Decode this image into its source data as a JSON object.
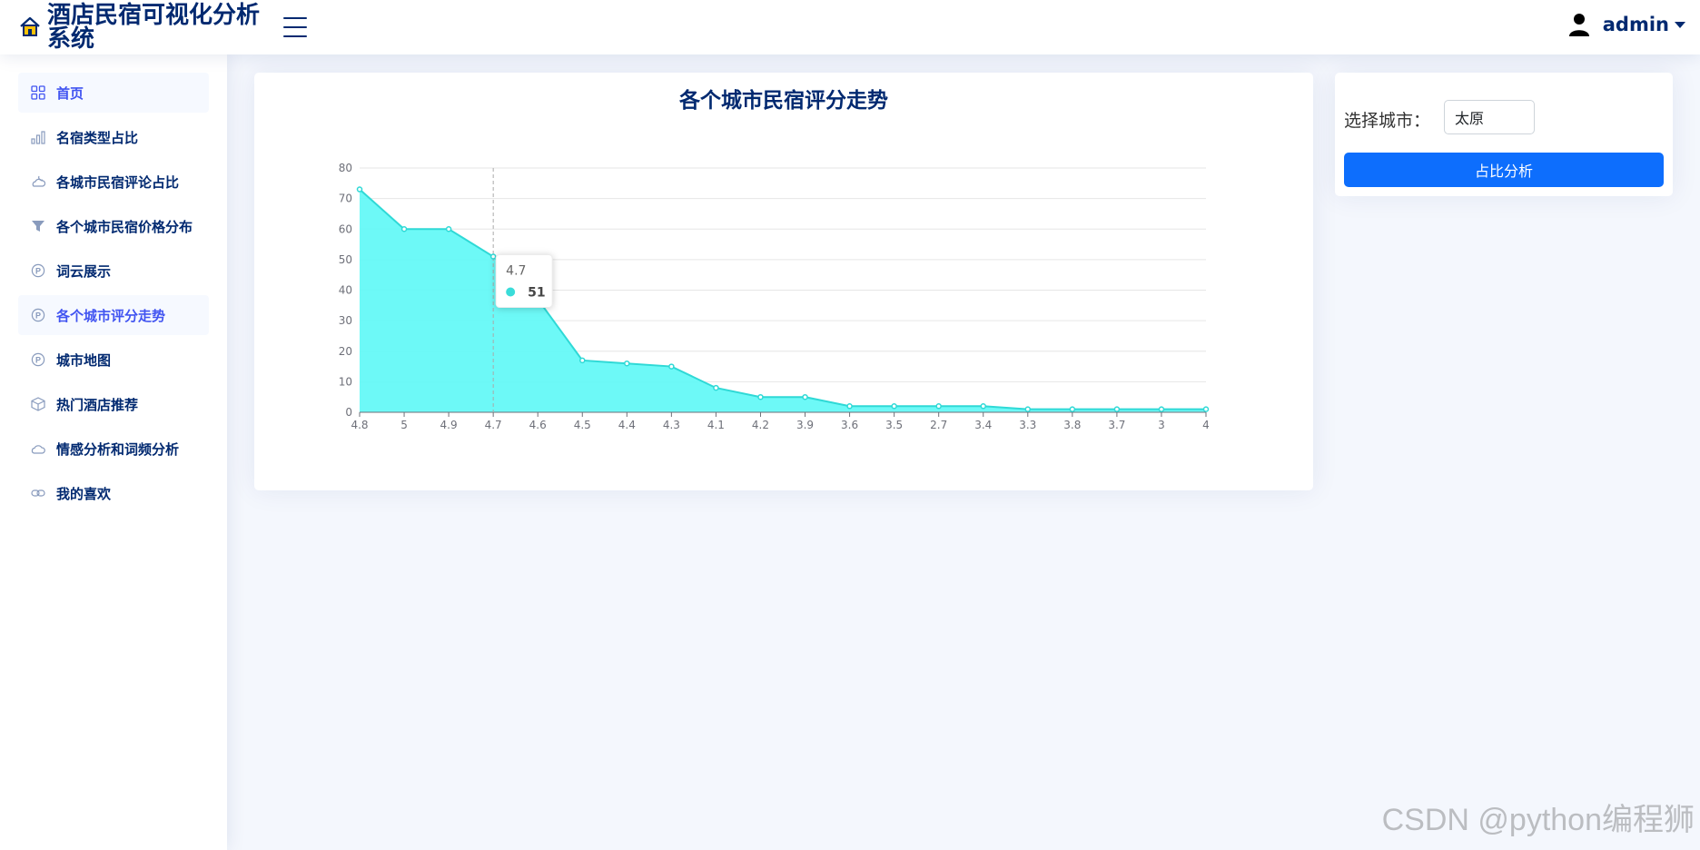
{
  "app": {
    "title": "酒店民宿可视化分析系统",
    "user": "admin"
  },
  "sidebar": {
    "items": [
      {
        "label": "首页",
        "icon": "grid-icon",
        "active": true
      },
      {
        "label": "名宿类型占比",
        "icon": "bar-chart-icon",
        "active": false
      },
      {
        "label": "各城市民宿评论占比",
        "icon": "cloud-moon-icon",
        "active": false
      },
      {
        "label": "各个城市民宿价格分布",
        "icon": "funnel-icon",
        "active": false
      },
      {
        "label": "词云展示",
        "icon": "p-circle-icon",
        "active": false
      },
      {
        "label": "各个城市评分走势",
        "icon": "p-circle-icon",
        "active": true
      },
      {
        "label": "城市地图",
        "icon": "p-circle-icon",
        "active": false
      },
      {
        "label": "热门酒店推荐",
        "icon": "box-icon",
        "active": false
      },
      {
        "label": "情感分析和词频分析",
        "icon": "cloud-icon",
        "active": false
      },
      {
        "label": "我的喜欢",
        "icon": "link-icon",
        "active": false
      }
    ]
  },
  "filter": {
    "label": "选择城市：",
    "city": "太原",
    "button": "占比分析"
  },
  "chart_data": {
    "type": "area",
    "title": "各个城市民宿评分走势",
    "categories": [
      "4.8",
      "5",
      "4.9",
      "4.7",
      "4.6",
      "4.5",
      "4.4",
      "4.3",
      "4.1",
      "4.2",
      "3.9",
      "3.6",
      "3.5",
      "2.7",
      "3.4",
      "3.3",
      "3.8",
      "3.7",
      "3",
      "4"
    ],
    "values": [
      73,
      60,
      60,
      51,
      37,
      17,
      16,
      15,
      8,
      5,
      5,
      2,
      2,
      2,
      2,
      1,
      1,
      1,
      1,
      1
    ],
    "ylim": [
      0,
      80
    ],
    "yticks": [
      0,
      10,
      20,
      30,
      40,
      50,
      60,
      70,
      80
    ],
    "color": "#5df8f6",
    "line_color": "#2fd9d6",
    "grid": true,
    "tooltip": {
      "label": "4.7",
      "value": "51"
    }
  },
  "watermark": "CSDN @python编程狮"
}
